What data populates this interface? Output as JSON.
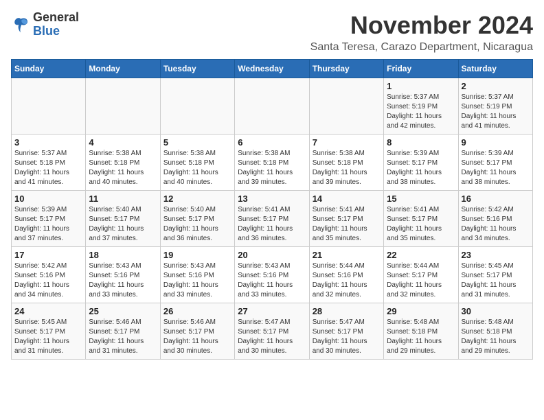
{
  "logo": {
    "general": "General",
    "blue": "Blue"
  },
  "header": {
    "month_title": "November 2024",
    "location": "Santa Teresa, Carazo Department, Nicaragua"
  },
  "weekdays": [
    "Sunday",
    "Monday",
    "Tuesday",
    "Wednesday",
    "Thursday",
    "Friday",
    "Saturday"
  ],
  "weeks": [
    [
      {
        "day": "",
        "info": ""
      },
      {
        "day": "",
        "info": ""
      },
      {
        "day": "",
        "info": ""
      },
      {
        "day": "",
        "info": ""
      },
      {
        "day": "",
        "info": ""
      },
      {
        "day": "1",
        "info": "Sunrise: 5:37 AM\nSunset: 5:19 PM\nDaylight: 11 hours\nand 42 minutes."
      },
      {
        "day": "2",
        "info": "Sunrise: 5:37 AM\nSunset: 5:19 PM\nDaylight: 11 hours\nand 41 minutes."
      }
    ],
    [
      {
        "day": "3",
        "info": "Sunrise: 5:37 AM\nSunset: 5:18 PM\nDaylight: 11 hours\nand 41 minutes."
      },
      {
        "day": "4",
        "info": "Sunrise: 5:38 AM\nSunset: 5:18 PM\nDaylight: 11 hours\nand 40 minutes."
      },
      {
        "day": "5",
        "info": "Sunrise: 5:38 AM\nSunset: 5:18 PM\nDaylight: 11 hours\nand 40 minutes."
      },
      {
        "day": "6",
        "info": "Sunrise: 5:38 AM\nSunset: 5:18 PM\nDaylight: 11 hours\nand 39 minutes."
      },
      {
        "day": "7",
        "info": "Sunrise: 5:38 AM\nSunset: 5:18 PM\nDaylight: 11 hours\nand 39 minutes."
      },
      {
        "day": "8",
        "info": "Sunrise: 5:39 AM\nSunset: 5:17 PM\nDaylight: 11 hours\nand 38 minutes."
      },
      {
        "day": "9",
        "info": "Sunrise: 5:39 AM\nSunset: 5:17 PM\nDaylight: 11 hours\nand 38 minutes."
      }
    ],
    [
      {
        "day": "10",
        "info": "Sunrise: 5:39 AM\nSunset: 5:17 PM\nDaylight: 11 hours\nand 37 minutes."
      },
      {
        "day": "11",
        "info": "Sunrise: 5:40 AM\nSunset: 5:17 PM\nDaylight: 11 hours\nand 37 minutes."
      },
      {
        "day": "12",
        "info": "Sunrise: 5:40 AM\nSunset: 5:17 PM\nDaylight: 11 hours\nand 36 minutes."
      },
      {
        "day": "13",
        "info": "Sunrise: 5:41 AM\nSunset: 5:17 PM\nDaylight: 11 hours\nand 36 minutes."
      },
      {
        "day": "14",
        "info": "Sunrise: 5:41 AM\nSunset: 5:17 PM\nDaylight: 11 hours\nand 35 minutes."
      },
      {
        "day": "15",
        "info": "Sunrise: 5:41 AM\nSunset: 5:17 PM\nDaylight: 11 hours\nand 35 minutes."
      },
      {
        "day": "16",
        "info": "Sunrise: 5:42 AM\nSunset: 5:16 PM\nDaylight: 11 hours\nand 34 minutes."
      }
    ],
    [
      {
        "day": "17",
        "info": "Sunrise: 5:42 AM\nSunset: 5:16 PM\nDaylight: 11 hours\nand 34 minutes."
      },
      {
        "day": "18",
        "info": "Sunrise: 5:43 AM\nSunset: 5:16 PM\nDaylight: 11 hours\nand 33 minutes."
      },
      {
        "day": "19",
        "info": "Sunrise: 5:43 AM\nSunset: 5:16 PM\nDaylight: 11 hours\nand 33 minutes."
      },
      {
        "day": "20",
        "info": "Sunrise: 5:43 AM\nSunset: 5:16 PM\nDaylight: 11 hours\nand 33 minutes."
      },
      {
        "day": "21",
        "info": "Sunrise: 5:44 AM\nSunset: 5:16 PM\nDaylight: 11 hours\nand 32 minutes."
      },
      {
        "day": "22",
        "info": "Sunrise: 5:44 AM\nSunset: 5:17 PM\nDaylight: 11 hours\nand 32 minutes."
      },
      {
        "day": "23",
        "info": "Sunrise: 5:45 AM\nSunset: 5:17 PM\nDaylight: 11 hours\nand 31 minutes."
      }
    ],
    [
      {
        "day": "24",
        "info": "Sunrise: 5:45 AM\nSunset: 5:17 PM\nDaylight: 11 hours\nand 31 minutes."
      },
      {
        "day": "25",
        "info": "Sunrise: 5:46 AM\nSunset: 5:17 PM\nDaylight: 11 hours\nand 31 minutes."
      },
      {
        "day": "26",
        "info": "Sunrise: 5:46 AM\nSunset: 5:17 PM\nDaylight: 11 hours\nand 30 minutes."
      },
      {
        "day": "27",
        "info": "Sunrise: 5:47 AM\nSunset: 5:17 PM\nDaylight: 11 hours\nand 30 minutes."
      },
      {
        "day": "28",
        "info": "Sunrise: 5:47 AM\nSunset: 5:17 PM\nDaylight: 11 hours\nand 30 minutes."
      },
      {
        "day": "29",
        "info": "Sunrise: 5:48 AM\nSunset: 5:18 PM\nDaylight: 11 hours\nand 29 minutes."
      },
      {
        "day": "30",
        "info": "Sunrise: 5:48 AM\nSunset: 5:18 PM\nDaylight: 11 hours\nand 29 minutes."
      }
    ]
  ]
}
